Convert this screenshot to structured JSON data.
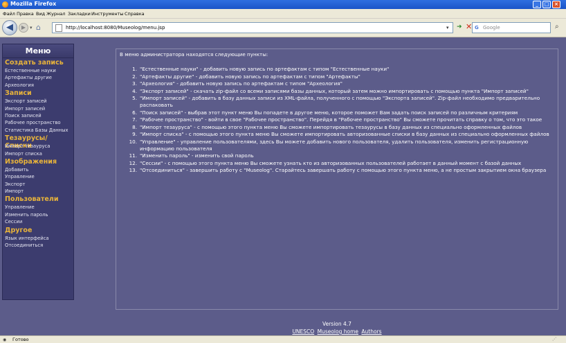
{
  "window": {
    "title": "Mozilla Firefox",
    "min": "_",
    "max": "□",
    "close": "×"
  },
  "menubar": [
    "Файл",
    "Правка",
    "Вид",
    "Журнал",
    "Закладки",
    "Инструменты",
    "Справка"
  ],
  "nav": {
    "back": "◀",
    "forward": "▶",
    "url": "http://localhost:8080/Museolog/menu.jsp",
    "search_placeholder": "Google",
    "search_engine_glyph": "G"
  },
  "sidebar": {
    "title": "Меню",
    "sections": [
      {
        "title": "Создать запись",
        "items": [
          "Естественные науки",
          "Артефакты другие",
          "Археология"
        ]
      },
      {
        "title": "Записи",
        "items": [
          "Экспорт записей",
          "Импорт записей",
          "Поиск записей",
          "Рабочее пространство",
          "Статистика Базы Данных"
        ]
      },
      {
        "title": "Тезаурусы/Списки",
        "items": [
          "Импорт тезауруса",
          "Импорт списка"
        ]
      },
      {
        "title": "Изображения",
        "items": [
          "Добавить",
          "Управление",
          "Экспорт",
          "Импорт"
        ]
      },
      {
        "title": "Пользователи",
        "items": [
          "Управление",
          "Изменить пароль",
          "Сессии"
        ]
      },
      {
        "title": "Другое",
        "items": [
          "Язык интерфейса",
          "Отсоединиться"
        ]
      }
    ]
  },
  "content": {
    "intro": "В меню администратора находятся следующие пункты:",
    "items": [
      "\"Естественные науки\" - добавить новую запись по артефактам с типом \"Естественные науки\"",
      "\"Артефакты другие\" - добавить новую запись по артефактам с типом \"Артефакты\"",
      "\"Археология\" - добавить новую запись по артефактам с типом \"Археология\"",
      "\"Экспорт записей\" - скачать zip-файл со всеми записями базы данных, который затем можно импортировать с помощью пункта \"Импорт записей\"",
      "\"Импорт записей\" - добавить в базу данных записи из XML-файла, полученного с помощью \"Экспорта записей\". Zip-файл необходимо предварительно распаковать",
      "\"Поиск записей\" - выбрав этот пункт меню Вы попадете в другое меню, которое поможет Вам задать поиск записей по различным критериям",
      "\"Рабочее пространство\" - войти в свое \"Рабочее пространство\". Перейдя в \"Рабочее пространство\" Вы сможете прочитать справку о том, что это такое",
      "\"Импорт тезауруса\" - с помощью этого пункта меню Вы сможете импортировать тезаурусы в базу данных из специально оформленных файлов",
      "\"Импорт списка\" - с помощью этого пункта меню Вы сможете импортировать авторизованные списки в базу данных из специально оформленных файлов",
      "\"Управление\" - управление пользователями, здесь Вы можете добавить нового пользователя, удалить пользователя, изменить регистрационную информацию пользователя",
      "\"Изменить пароль\" - изменить свой пароль",
      "\"Сессии\" - с помощью этого пункта меню Вы сможете узнать кто из авторизованных пользователей работает в данный момент с базой данных",
      "\"Отсоединиться\" - завершить работу с \"Museolog\". Старайтесь завершать работу с помощью этого пункта меню, а не простым закрытием окна браузера"
    ]
  },
  "footer": {
    "version": "Version 4.7",
    "links": [
      "UNESCO",
      "Museolog home",
      "Authors"
    ]
  },
  "status": {
    "text": "Готово"
  },
  "colors": {
    "page_bg": "#5c5c8a",
    "sidebar_bg": "#3c3c6e",
    "section_title": "#e9b43a",
    "titlebar": "#2f6fe0"
  }
}
